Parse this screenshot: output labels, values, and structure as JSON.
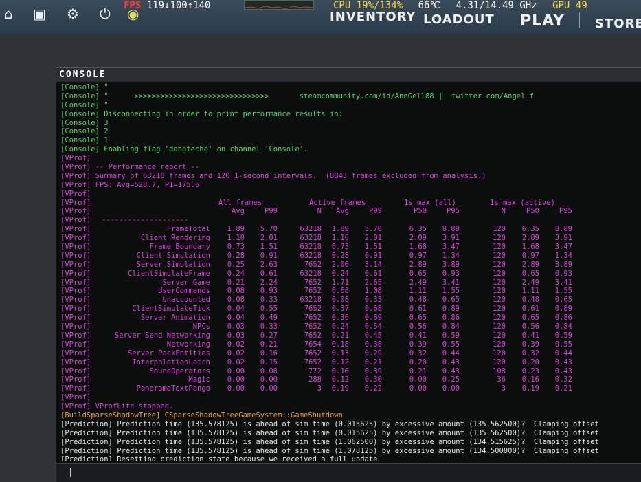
{
  "topbar": {
    "icons": [
      "home-icon",
      "tv-icon",
      "gear-icon",
      "power-icon",
      "tv-award-icon"
    ],
    "nav": [
      "INVENTORY",
      "LOADOUT",
      "PLAY",
      "STORE"
    ]
  },
  "overlay": {
    "fps_label": "FPS",
    "fps_values": "119↓100↑140",
    "cpu": "CPU 19%/134%",
    "temp": "66℃",
    "clock": "4.31/14.49 GHz",
    "gpu": "GPU 49"
  },
  "console": {
    "title": "CONSOLE",
    "intro_lines": [
      {
        "prefix": "[Console]",
        "text": "\"",
        "color": "green"
      },
      {
        "prefix": "[Console]",
        "text": "\"      >>>>>>>>>>>>>>>>>>>>>>>>>>>>>>>       steamcommunity.com/id/AnnGell88 || twitter.com/Angel_f",
        "color": "green"
      },
      {
        "prefix": "[Console]",
        "text": "\"",
        "color": "green"
      },
      {
        "prefix": "[Console]",
        "text": "Disconnecting in order to print performance results in:",
        "color": "green"
      },
      {
        "prefix": "[Console]",
        "text": "3",
        "color": "green"
      },
      {
        "prefix": "[Console]",
        "text": "2",
        "color": "green"
      },
      {
        "prefix": "[Console]",
        "text": "1",
        "color": "green"
      },
      {
        "prefix": "[Console]",
        "text": "Enabling flag 'donotecho' on channel 'Console'.",
        "color": "green"
      },
      {
        "prefix": "[VProf]",
        "text": "",
        "color": "magenta"
      },
      {
        "prefix": "[VProf]",
        "text": "-- Performance report --",
        "color": "magenta"
      },
      {
        "prefix": "[VProf]",
        "text": "Summary of 63218 frames and 120 1-second intervals.  (8843 frames excluded from analysis.)",
        "color": "magenta"
      },
      {
        "prefix": "[VProf]",
        "text": "FPS: Avg=528.7, P1=175.6",
        "color": "magenta"
      },
      {
        "prefix": "[VProf]",
        "text": "",
        "color": "magenta"
      }
    ],
    "table_header1": [
      "All frames",
      "Active frames",
      "1s max (all)",
      "1s max (active)"
    ],
    "table_header2": [
      "Avg",
      "P99",
      "N",
      "Avg",
      "P99",
      "P50",
      "P95",
      "N",
      "P50",
      "P95"
    ],
    "table_rule": "--------------------",
    "rows": [
      {
        "name": "FrameTotal",
        "v": [
          "1.89",
          "5.70",
          "63218",
          "1.89",
          "5.70",
          "6.35",
          "8.89",
          "120",
          "6.35",
          "8.89"
        ]
      },
      {
        "name": "Client Rendering",
        "v": [
          "1.10",
          "2.01",
          "63218",
          "1.10",
          "2.01",
          "2.09",
          "3.91",
          "120",
          "2.09",
          "3.91"
        ]
      },
      {
        "name": "Frame Boundary",
        "v": [
          "0.73",
          "1.51",
          "63218",
          "0.73",
          "1.51",
          "1.68",
          "3.47",
          "120",
          "1.68",
          "3.47"
        ]
      },
      {
        "name": "Client Simulation",
        "v": [
          "0.28",
          "0.91",
          "63218",
          "0.28",
          "0.91",
          "0.97",
          "1.34",
          "120",
          "0.97",
          "1.34"
        ]
      },
      {
        "name": "Server Simulation",
        "v": [
          "0.25",
          "2.63",
          "7652",
          "2.06",
          "3.14",
          "2.89",
          "3.89",
          "120",
          "2.89",
          "3.89"
        ]
      },
      {
        "name": "ClientSimulateFrame",
        "v": [
          "0.24",
          "0.61",
          "63218",
          "0.24",
          "0.61",
          "0.65",
          "0.93",
          "120",
          "0.65",
          "0.93"
        ]
      },
      {
        "name": "Server Game",
        "v": [
          "0.21",
          "2.24",
          "7652",
          "1.71",
          "2.65",
          "2.49",
          "3.41",
          "120",
          "2.49",
          "3.41"
        ]
      },
      {
        "name": "UserCommands",
        "v": [
          "0.08",
          "0.93",
          "7652",
          "0.68",
          "1.08",
          "1.11",
          "1.55",
          "120",
          "1.11",
          "1.55"
        ]
      },
      {
        "name": "Unaccounted",
        "v": [
          "0.08",
          "0.33",
          "63218",
          "0.08",
          "0.33",
          "0.48",
          "0.65",
          "120",
          "0.48",
          "0.65"
        ]
      },
      {
        "name": "ClientSimulateTick",
        "v": [
          "0.04",
          "0.55",
          "7652",
          "0.37",
          "0.68",
          "0.61",
          "0.89",
          "120",
          "0.61",
          "0.89"
        ]
      },
      {
        "name": "Server Animation",
        "v": [
          "0.04",
          "0.49",
          "7652",
          "0.36",
          "0.69",
          "0.65",
          "0.86",
          "120",
          "0.65",
          "0.86"
        ]
      },
      {
        "name": "NPCs",
        "v": [
          "0.03",
          "0.33",
          "7652",
          "0.24",
          "0.54",
          "0.56",
          "0.84",
          "120",
          "0.56",
          "0.84"
        ]
      },
      {
        "name": "Server Send Networking",
        "v": [
          "0.03",
          "0.27",
          "7652",
          "0.21",
          "0.45",
          "0.41",
          "0.59",
          "120",
          "0.41",
          "0.59"
        ]
      },
      {
        "name": "Networking",
        "v": [
          "0.02",
          "0.21",
          "7654",
          "0.18",
          "0.38",
          "0.39",
          "0.55",
          "120",
          "0.39",
          "0.55"
        ]
      },
      {
        "name": "Server PackEntities",
        "v": [
          "0.02",
          "0.16",
          "7652",
          "0.13",
          "0.29",
          "0.32",
          "0.44",
          "120",
          "0.32",
          "0.44"
        ]
      },
      {
        "name": "InterpolationLatch",
        "v": [
          "0.02",
          "0.15",
          "7652",
          "0.12",
          "0.21",
          "0.20",
          "0.43",
          "120",
          "0.20",
          "0.43"
        ]
      },
      {
        "name": "SoundOperators",
        "v": [
          "0.00",
          "0.08",
          "772",
          "0.16",
          "0.39",
          "0.21",
          "0.43",
          "108",
          "0.23",
          "0.43"
        ]
      },
      {
        "name": "Magic",
        "v": [
          "0.00",
          "0.00",
          "288",
          "0.12",
          "0.30",
          "0.00",
          "0.25",
          "36",
          "0.16",
          "0.32"
        ]
      },
      {
        "name": "PanoramaTextPango",
        "v": [
          "0.00",
          "0.00",
          "3",
          "0.19",
          "0.22",
          "0.00",
          "0.00",
          "3",
          "0.19",
          "0.21"
        ]
      }
    ],
    "outro_lines": [
      {
        "prefix": "[VProf]",
        "text": "",
        "color": "magenta"
      },
      {
        "prefix": "[VProf]",
        "text": "VProfLite stopped.",
        "color": "magenta"
      },
      {
        "prefix": "[BuildSparseShadowTree]",
        "text": "CSparseShadowTreeGameSystem::GameShutdown",
        "color": "orange"
      },
      {
        "prefix": "[Prediction]",
        "text": "Prediction time (135.578125) is ahead of sim time (0.015625) by excessive amount (135.562500)?  Clamping offset",
        "color": "white"
      },
      {
        "prefix": "[Prediction]",
        "text": "Prediction time (135.578125) is ahead of sim time (0.015625) by excessive amount (135.562500)?  Clamping offset",
        "color": "white"
      },
      {
        "prefix": "[Prediction]",
        "text": "Prediction time (135.578125) is ahead of sim time (1.062500) by excessive amount (134.515625)?  Clamping offset",
        "color": "white"
      },
      {
        "prefix": "[Prediction]",
        "text": "Prediction time (135.578125) is ahead of sim time (1.078125) by excessive amount (134.500000)?  Clamping offset",
        "color": "white"
      },
      {
        "prefix": "[Prediction]",
        "text": "Resetting prediction state because we received a full update",
        "color": "white"
      }
    ]
  }
}
